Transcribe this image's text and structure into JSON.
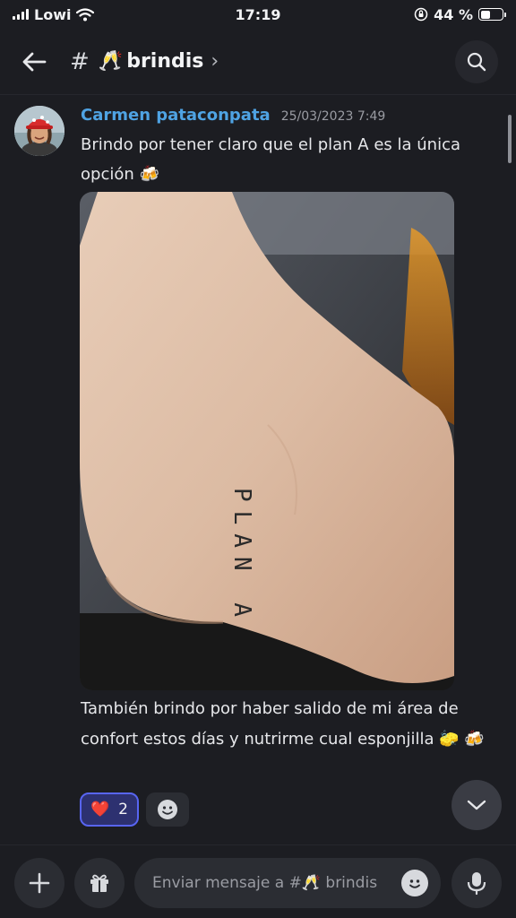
{
  "status_bar": {
    "carrier": "Lowi",
    "time": "17:19",
    "battery": "44 %",
    "battery_level": 0.44
  },
  "header": {
    "hash": "#",
    "channel_emoji": "🥂",
    "channel_name": "brindis",
    "chevron": "›"
  },
  "message": {
    "author": "Carmen pataconpata",
    "timestamp": "25/03/2023 7:49",
    "text_1": "Brindo por tener claro que el plan A es la única opción 🍻",
    "text_2": "También brindo por haber salido de mi área de confort estos días y nutrirme cual esponjilla 🧽 🍻",
    "image_text": "PLAN A",
    "reactions": [
      {
        "emoji": "❤️",
        "count": "2"
      }
    ]
  },
  "composer": {
    "placeholder": "Enviar mensaje a #🥂 brindis"
  },
  "icons": {
    "back": "back-arrow-icon",
    "search": "search-icon",
    "add": "plus-icon",
    "gift": "gift-icon",
    "emoji": "emoji-icon",
    "mic": "microphone-icon",
    "jump": "chevron-down-icon",
    "add_reaction": "add-reaction-icon"
  },
  "colors": {
    "accent": "#5865f2",
    "author": "#4fa3e3",
    "background": "#1c1d22"
  }
}
